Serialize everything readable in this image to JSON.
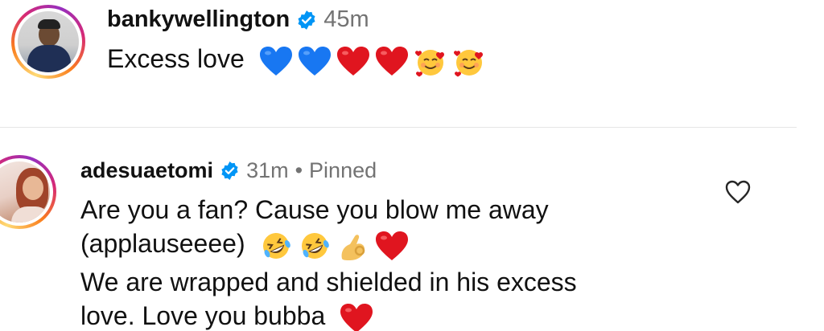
{
  "comments": [
    {
      "username": "bankywellington",
      "time": "45m",
      "text": "Excess love",
      "emojis": [
        "blue-heart-emoji",
        "blue-heart-emoji",
        "red-heart-emoji",
        "red-heart-emoji",
        "smiling-face-with-hearts-emoji",
        "smiling-face-with-hearts-emoji"
      ]
    },
    {
      "username": "adesuaetomi",
      "time": "31m",
      "separator": "•",
      "pinned_label": "Pinned",
      "text_line1": "Are you a fan? Cause you blow me away",
      "text_line2": "(applauseeee)",
      "text_line3": "We are wrapped and shielded in his excess",
      "text_line4": "love. Love you bubba",
      "emojis_line2": [
        "rolling-laughing-emoji",
        "rolling-laughing-emoji",
        "ok-hand-emoji",
        "red-heart-emoji"
      ],
      "emojis_line4": [
        "red-heart-emoji"
      ]
    }
  ],
  "colors": {
    "verified_blue": "#0095f6",
    "meta_gray": "#737373",
    "blue_heart": "#1877f2",
    "red_heart": "#e0151f"
  }
}
